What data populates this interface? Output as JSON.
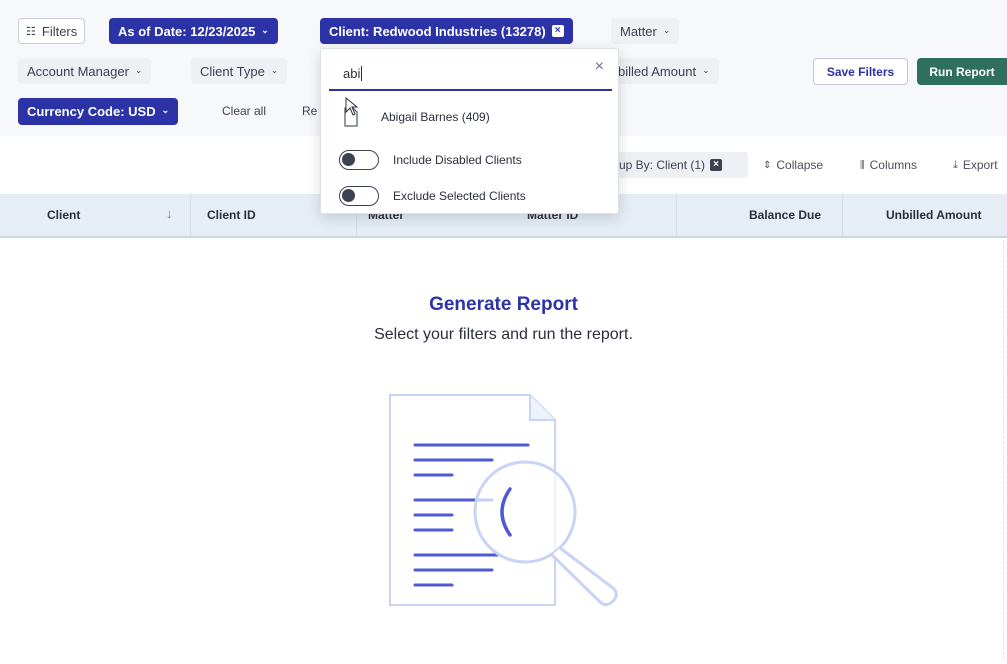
{
  "filters": {
    "filters_label": "Filters",
    "as_of_date": "As of Date: 12/23/2025",
    "client": "Client: Redwood Industries (13278)",
    "matter": "Matter",
    "account_manager": "Account Manager",
    "client_type": "Client Type",
    "unbilled_amount": "billed Amount",
    "currency_code": "Currency Code: USD",
    "clear_all": "Clear all",
    "reset_partial": "Re",
    "save_filters": "Save Filters",
    "run_report": "Run Report"
  },
  "client_dropdown": {
    "search_value": "abi",
    "option_label": "Abigail Barnes (409)",
    "include_disabled": "Include Disabled Clients",
    "exclude_selected": "Exclude Selected Clients"
  },
  "toolbar": {
    "group_by": "up By: Client (1)",
    "collapse": "Collapse",
    "columns": "Columns",
    "export": "Export"
  },
  "table": {
    "columns": [
      "Client",
      "Client ID",
      "Matter",
      "Matter ID",
      "Balance Due",
      "Unbilled Amount"
    ]
  },
  "empty_state": {
    "title": "Generate Report",
    "subtitle": "Select your filters and run the report."
  },
  "colors": {
    "accent": "#2b33a6",
    "run_button": "#2f6f5e",
    "header_bg": "#e7edf5",
    "illustration": "#4c5ad6"
  },
  "icons": {
    "filters": "sliders-icon",
    "sort": "arrow-down-icon",
    "option": "document-icon",
    "collapse": "collapse-icon",
    "columns": "columns-icon",
    "export": "download-icon"
  }
}
